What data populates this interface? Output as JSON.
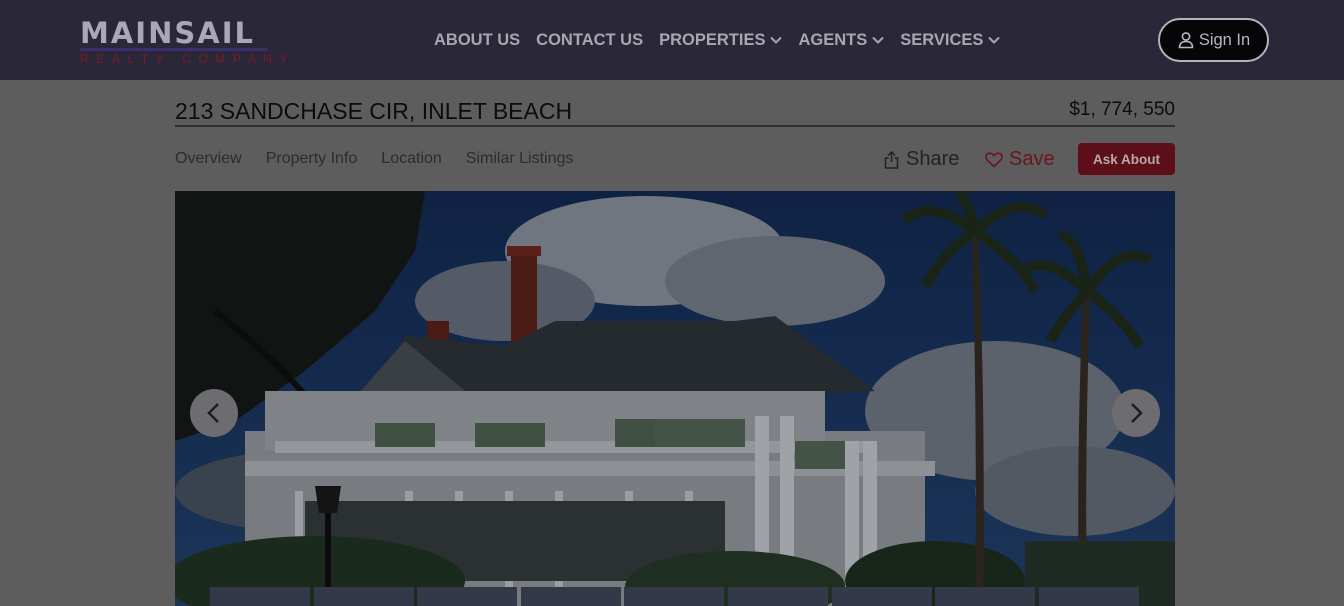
{
  "header": {
    "logo": {
      "name": "MAINSAIL",
      "sub": "REALTY COMPANY"
    },
    "nav": [
      {
        "label": "ABOUT US",
        "has_dropdown": false
      },
      {
        "label": "CONTACT US",
        "has_dropdown": false
      },
      {
        "label": "PROPERTIES",
        "has_dropdown": true
      },
      {
        "label": "AGENTS",
        "has_dropdown": true
      },
      {
        "label": "SERVICES",
        "has_dropdown": true
      }
    ],
    "sign_in": {
      "label": "Sign In",
      "icon": "user-icon"
    }
  },
  "listing": {
    "address": "213 SANDCHASE CIR, INLET BEACH",
    "price": "$1, 774, 550",
    "tabs": [
      "Overview",
      "Property Info",
      "Location",
      "Similar Listings"
    ],
    "actions": {
      "share": {
        "label": "Share",
        "icon": "share-icon"
      },
      "save": {
        "label": "Save",
        "icon": "heart-icon"
      },
      "ask": {
        "label": "Ask About"
      }
    }
  },
  "gallery": {
    "prev_icon": "chevron-left-icon",
    "next_icon": "chevron-right-icon",
    "thumbnail_count": 9
  },
  "colors": {
    "header_bg": "#2a2738",
    "page_bg": "#5d5d5d",
    "accent": "#5c0f19"
  }
}
